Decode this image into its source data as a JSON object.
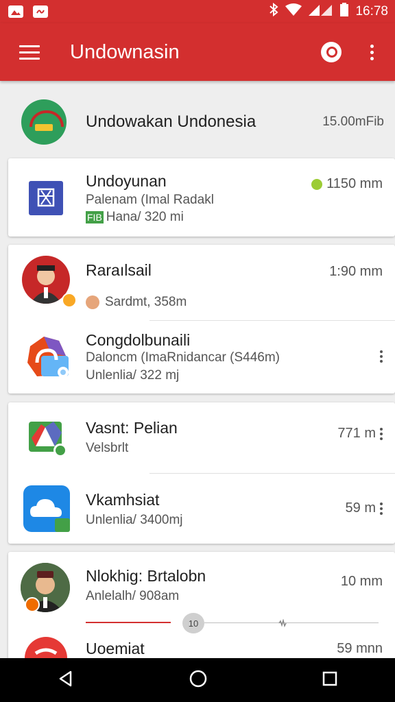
{
  "status_bar": {
    "time": "16:78"
  },
  "app_bar": {
    "title": "Undownasin"
  },
  "header": {
    "name": "Undowakan Undonesia",
    "meta": "15.00mFib"
  },
  "cards": [
    {
      "items": [
        {
          "title": "Undoyunan",
          "line2": "Palenam (Imal Radakl",
          "line3": "Hana/ 320 mi",
          "line3_tag": "FIB",
          "right": "1150 mm",
          "icon": "document-icon"
        }
      ]
    },
    {
      "items": [
        {
          "title": "Raraılsail",
          "line2": "Sardmt, 358m",
          "right": "1:90 mm",
          "icon": "avatar"
        },
        {
          "title": "Congdolbunaili",
          "line2": "Daloncm (ImaRnidancar (S446m)",
          "line3": "Unlenlia/ 322 mj",
          "icon": "folder-icon"
        }
      ]
    },
    {
      "items": [
        {
          "title": "Vasnt: Pelian",
          "line2": "Velsbrlt",
          "right": "771 m",
          "icon": "drive-icon"
        },
        {
          "title": "Vkamhsiat",
          "line2": "Unlenlia/ 3400mj",
          "right": "59 m",
          "icon": "cloud-icon"
        }
      ]
    },
    {
      "items": [
        {
          "title": "Nlokhig: Brtalobn",
          "line2": "Anlelalh/ 908am",
          "right": "10 mm",
          "icon": "avatar",
          "player_label": "10"
        },
        {
          "title": "Uoemiat",
          "right": "59 mnn",
          "icon": "app-icon"
        }
      ]
    }
  ]
}
